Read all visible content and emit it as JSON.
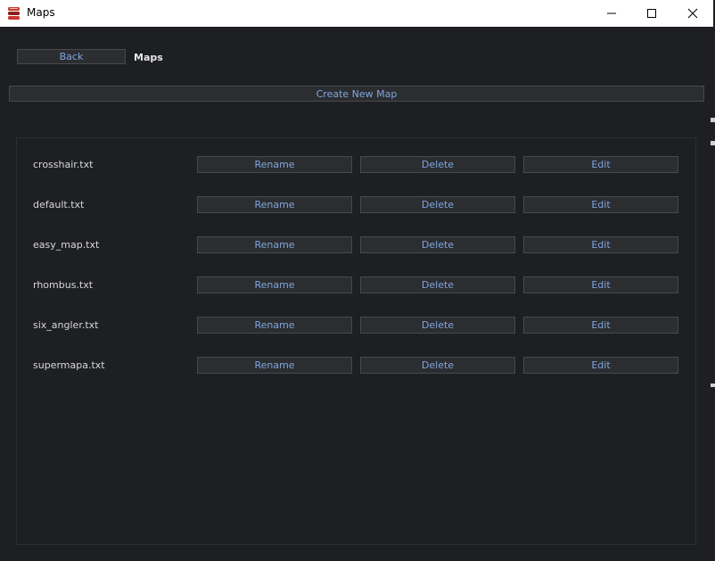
{
  "window": {
    "title": "Maps",
    "app_icon": "stacked-layers-icon",
    "controls": {
      "minimize": "minimize-icon",
      "maximize": "maximize-icon",
      "close": "close-icon"
    }
  },
  "toolbar": {
    "back_label": "Back",
    "page_title": "Maps",
    "create_label": "Create New Map"
  },
  "maps": [
    {
      "name": "crosshair.txt",
      "rename": "Rename",
      "delete": "Delete",
      "edit": "Edit"
    },
    {
      "name": "default.txt",
      "rename": "Rename",
      "delete": "Delete",
      "edit": "Edit"
    },
    {
      "name": "easy_map.txt",
      "rename": "Rename",
      "delete": "Delete",
      "edit": "Edit"
    },
    {
      "name": "rhombus.txt",
      "rename": "Rename",
      "delete": "Delete",
      "edit": "Edit"
    },
    {
      "name": "six_angler.txt",
      "rename": "Rename",
      "delete": "Delete",
      "edit": "Edit"
    },
    {
      "name": "supermapa.txt",
      "rename": "Rename",
      "delete": "Delete",
      "edit": "Edit"
    }
  ],
  "colors": {
    "background": "#1e1f22",
    "button_bg": "#2c2d30",
    "button_border": "#48494d",
    "accent_text": "#7fa6e0",
    "body_text": "#d8d8d8"
  }
}
